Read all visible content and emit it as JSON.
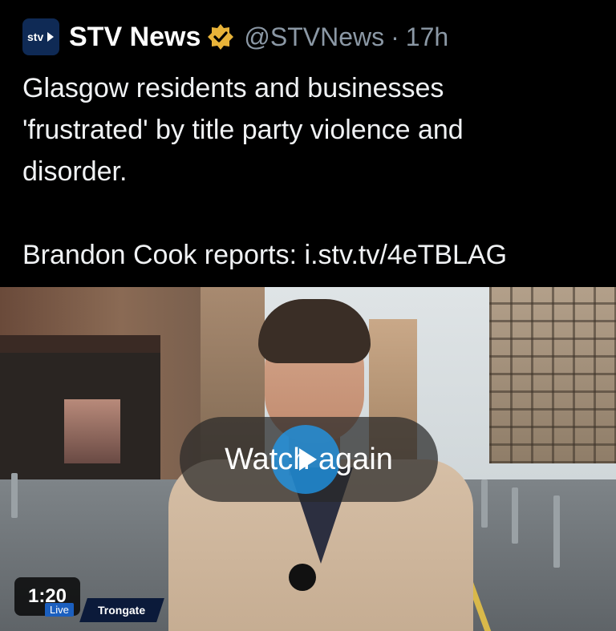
{
  "post": {
    "display_name": "STV News",
    "handle": "@STVNews",
    "separator": "·",
    "timestamp": "17h",
    "text_lines": [
      "Glasgow residents and businesses",
      "'frustrated' by title party violence and",
      "disorder."
    ],
    "reporter_line": "Brandon Cook reports: i.stv.tv/4eTBLAG"
  },
  "icons": {
    "avatar": "stv-logo-icon",
    "verified": "verified-badge-icon",
    "play": "play-icon"
  },
  "colors": {
    "background": "#000000",
    "verified_gold": "#e8b339",
    "play_blue": "#1d9bf0",
    "secondary_text": "#8b98a5"
  },
  "video": {
    "overlay_label": "Watch again",
    "duration": "1:20",
    "live_badge": "Live",
    "location": "Trongate"
  }
}
